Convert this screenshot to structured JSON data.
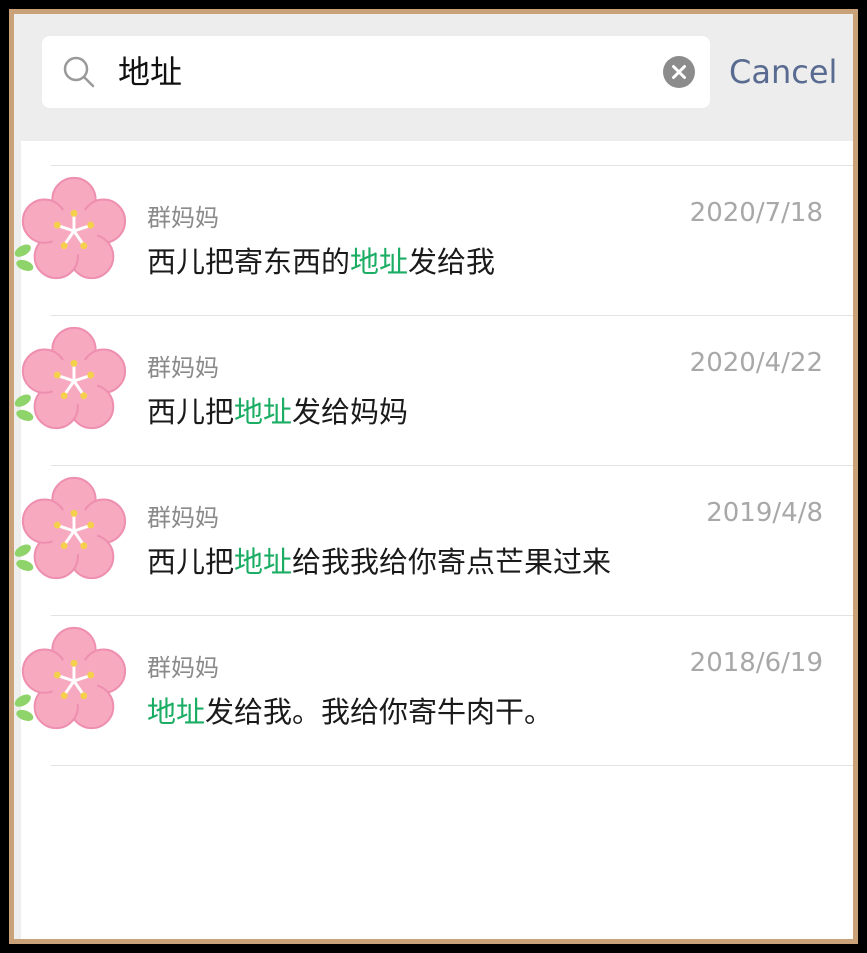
{
  "search": {
    "query": "地址",
    "cancel_label": "Cancel"
  },
  "colors": {
    "highlight": "#1aad63",
    "cancel": "#5a6b91",
    "frame": "#c9a27a"
  },
  "results": [
    {
      "name": "群妈妈",
      "date": "2020/7/18",
      "before": "西儿把寄东西的",
      "match": "地址",
      "after": "发给我"
    },
    {
      "name": "群妈妈",
      "date": "2020/4/22",
      "before": "西儿把",
      "match": "地址",
      "after": "发给妈妈"
    },
    {
      "name": "群妈妈",
      "date": "2019/4/8",
      "before": "西儿把",
      "match": "地址",
      "after": "给我我给你寄点芒果过来"
    },
    {
      "name": "群妈妈",
      "date": "2018/6/19",
      "before": "",
      "match": "地址",
      "after": "发给我。我给你寄牛肉干。"
    }
  ],
  "icons": {
    "search": "search-icon",
    "clear": "clear-icon",
    "avatar": "flower-avatar-icon"
  }
}
